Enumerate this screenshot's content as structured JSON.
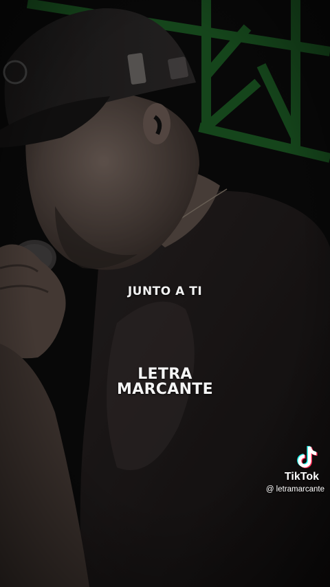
{
  "video": {
    "lyric": "JUNTO A TI",
    "brand_line1": "LETRA",
    "brand_line2": "MARCANTE"
  },
  "watermark": {
    "platform": "TikTok",
    "handle": "@ letramarcante",
    "icon": "tiktok-icon"
  },
  "colors": {
    "stage_truss": "#1f6b2a",
    "background": "#0d0d0d",
    "text": "#f5f5f5"
  }
}
